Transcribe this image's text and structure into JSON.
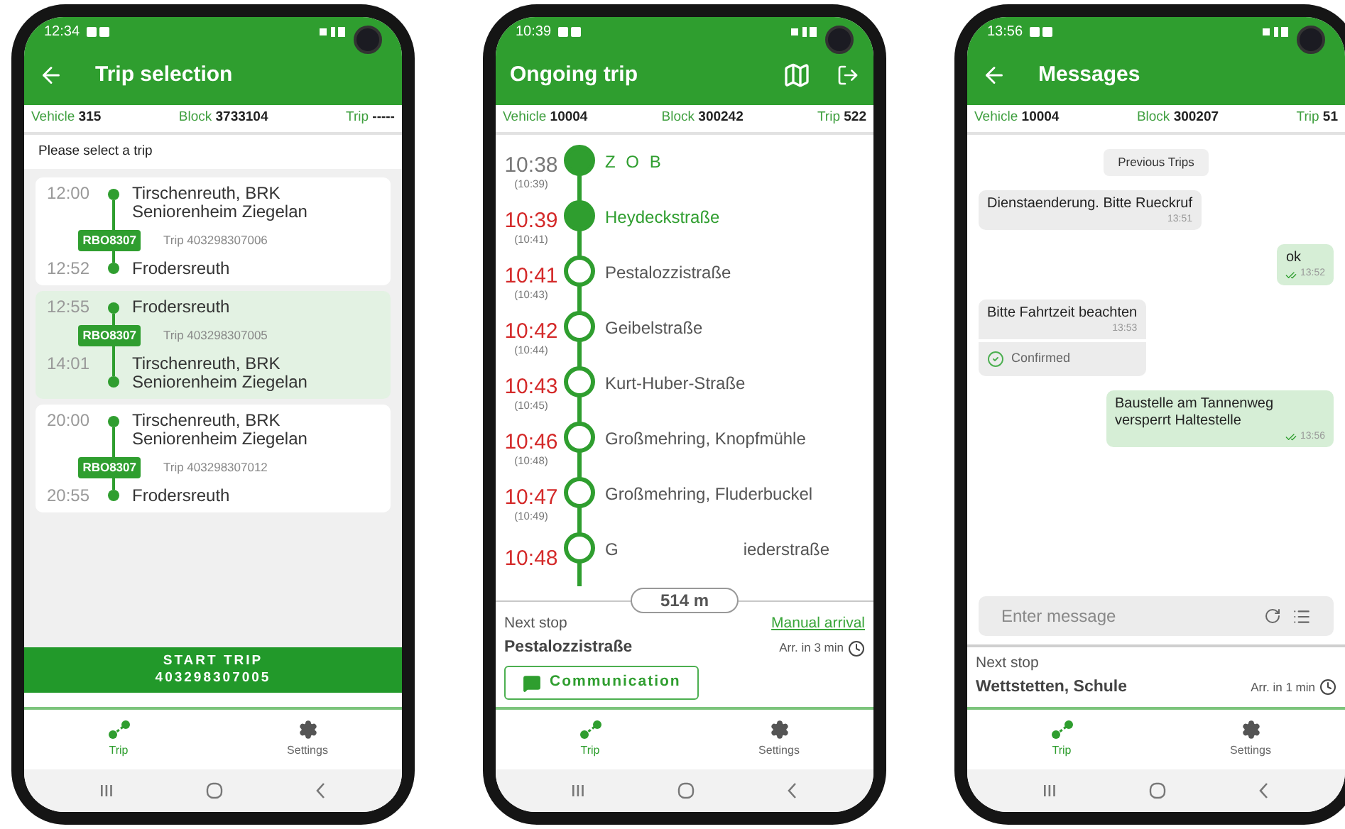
{
  "phones": [
    {
      "kind": "trip_selection",
      "status_time": "12:34",
      "header": {
        "title": "Trip selection",
        "back": true
      },
      "info": [
        {
          "label": "Vehicle",
          "value": "315"
        },
        {
          "label": "Block",
          "value": "3733104"
        },
        {
          "label": "Trip",
          "value": "-----"
        }
      ],
      "prompt": "Please select a trip",
      "trips": [
        {
          "selected": false,
          "start_time": "12:00",
          "start_stop": "Tirschenreuth, BRK Seniorenheim Ziegelan",
          "line": "RBO8307",
          "trip": "Trip 403298307006",
          "end_time": "12:52",
          "end_stop": "Frodersreuth"
        },
        {
          "selected": true,
          "start_time": "12:55",
          "start_stop": "Frodersreuth",
          "line": "RBO8307",
          "trip": "Trip 403298307005",
          "end_time": "14:01",
          "end_stop": "Tirschenreuth, BRK Seniorenheim Ziegelan"
        },
        {
          "selected": false,
          "start_time": "20:00",
          "start_stop": "Tirschenreuth, BRK Seniorenheim Ziegelan",
          "line": "RBO8307",
          "trip": "Trip 403298307012",
          "end_time": "20:55",
          "end_stop": "Frodersreuth"
        }
      ],
      "start_button": [
        "START TRIP",
        "403298307005"
      ],
      "tabs": [
        {
          "label": "Trip",
          "selected": true
        },
        {
          "label": "Settings",
          "selected": false
        }
      ]
    },
    {
      "kind": "ongoing_trip",
      "status_time": "10:39",
      "header": {
        "title": "Ongoing trip",
        "back": false
      },
      "info": [
        {
          "label": "Vehicle",
          "value": "10004"
        },
        {
          "label": "Block",
          "value": "300242"
        },
        {
          "label": "Trip",
          "value": "522"
        }
      ],
      "stops": [
        {
          "time": "10:38",
          "planned": "(10:39)",
          "name": "Z O B",
          "late": false,
          "passed": true
        },
        {
          "time": "10:39",
          "planned": "(10:41)",
          "name": "Heydeckstraße",
          "late": true,
          "passed": true
        },
        {
          "time": "10:41",
          "planned": "(10:43)",
          "name": "Pestalozzistraße",
          "late": true,
          "passed": false
        },
        {
          "time": "10:42",
          "planned": "(10:44)",
          "name": "Geibelstraße",
          "late": true,
          "passed": false
        },
        {
          "time": "10:43",
          "planned": "(10:45)",
          "name": "Kurt-Huber-Straße",
          "late": true,
          "passed": false
        },
        {
          "time": "10:46",
          "planned": "(10:48)",
          "name": "Großmehring, Knopfmühle",
          "late": true,
          "passed": false
        },
        {
          "time": "10:47",
          "planned": "(10:49)",
          "name": "Großmehring, Fluderbuckel",
          "late": true,
          "passed": false
        },
        {
          "time": "10:48",
          "name": "G",
          "name_end": "iederstraße",
          "late": true,
          "passed": false
        }
      ],
      "distance": "514 m",
      "next_stop_label": "Next stop",
      "next_stop": "Pestalozzistraße",
      "manual": "Manual arrival",
      "eta": "Arr. in 3 min",
      "communication": "Communication",
      "tabs": [
        {
          "label": "Trip",
          "selected": true
        },
        {
          "label": "Settings",
          "selected": false
        }
      ]
    },
    {
      "kind": "messages",
      "status_time": "13:56",
      "header": {
        "title": "Messages",
        "back": true
      },
      "info": [
        {
          "label": "Vehicle",
          "value": "10004"
        },
        {
          "label": "Block",
          "value": "300207"
        },
        {
          "label": "Trip",
          "value": "51"
        }
      ],
      "previous": "Previous Trips",
      "messages": [
        {
          "kind": "in",
          "text": "Dienstaenderung. Bitte Rueckruf",
          "time": "13:51"
        },
        {
          "kind": "out",
          "text": "ok",
          "time": "13:52"
        },
        {
          "kind": "in",
          "text": "Bitte Fahrtzeit beachten",
          "time": "13:53",
          "confirmation": "Confirmed"
        },
        {
          "kind": "out",
          "text": "Baustelle am Tannenweg versperrt Haltestelle",
          "time": "13:56"
        }
      ],
      "input": {
        "placeholder": "Enter message"
      },
      "next_stop_label": "Next stop",
      "next_stop": "Wettstetten, Schule",
      "eta": "Arr. in 1 min",
      "tabs": [
        {
          "label": "Trip",
          "selected": true
        },
        {
          "label": "Settings",
          "selected": false
        }
      ]
    }
  ]
}
